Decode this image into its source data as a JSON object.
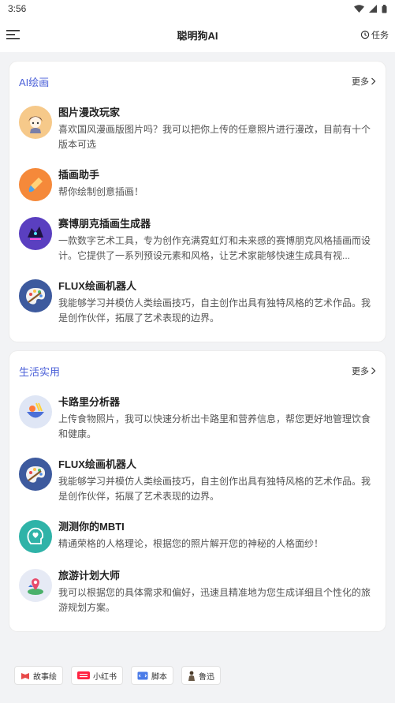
{
  "status": {
    "time": "3:56"
  },
  "header": {
    "title": "聪明狗AI",
    "tasks_label": "任务"
  },
  "sections": [
    {
      "title": "AI绘画",
      "more": "更多",
      "items": [
        {
          "name": "图片漫改玩家",
          "desc": "喜欢国风漫画版图片吗？我可以把你上传的任意照片进行漫改，目前有十个版本可选",
          "icon": "anime-girl-icon",
          "color": "#f6c98a"
        },
        {
          "name": "插画助手",
          "desc": "帮你绘制创意插画！",
          "icon": "paint-brush-icon",
          "color": "#f5893a"
        },
        {
          "name": "赛博朋克插画生成器",
          "desc": "一款数字艺术工具，专为创作充满霓虹灯和未来感的赛博朋克风格插画而设计。它提供了一系列预设元素和风格，让艺术家能够快速生成具有视...",
          "icon": "cyber-dragon-icon",
          "color": "#5a3fc0"
        },
        {
          "name": "FLUX绘画机器人",
          "desc": "我能够学习并模仿人类绘画技巧，自主创作出具有独特风格的艺术作品。我是创作伙伴，拓展了艺术表现的边界。",
          "icon": "palette-icon",
          "color": "#3d5a9e"
        }
      ]
    },
    {
      "title": "生活实用",
      "more": "更多",
      "items": [
        {
          "name": "卡路里分析器",
          "desc": "上传食物照片，我可以快速分析出卡路里和营养信息，帮您更好地管理饮食和健康。",
          "icon": "food-bowl-icon",
          "color": "#dfe6f5"
        },
        {
          "name": "FLUX绘画机器人",
          "desc": "我能够学习并模仿人类绘画技巧，自主创作出具有独特风格的艺术作品。我是创作伙伴，拓展了艺术表现的边界。",
          "icon": "palette-icon",
          "color": "#3d5a9e"
        },
        {
          "name": "测测你的MBTI",
          "desc": "精通荣格的人格理论，根据您的照片解开您的神秘的人格面纱！",
          "icon": "heart-head-icon",
          "color": "#2fb3a8"
        },
        {
          "name": "旅游计划大师",
          "desc": "我可以根据您的具体需求和偏好，迅速且精准地为您生成详细且个性化的旅游规划方案。",
          "icon": "map-pin-icon",
          "color": "#e6eaf5"
        }
      ]
    }
  ],
  "bottom_chips": [
    {
      "label": "故事绘",
      "icon": "story-icon"
    },
    {
      "label": "小红书",
      "icon": "xiaohongshu-icon"
    },
    {
      "label": "脚本",
      "icon": "script-icon"
    },
    {
      "label": "鲁迅",
      "icon": "luxun-icon"
    }
  ]
}
